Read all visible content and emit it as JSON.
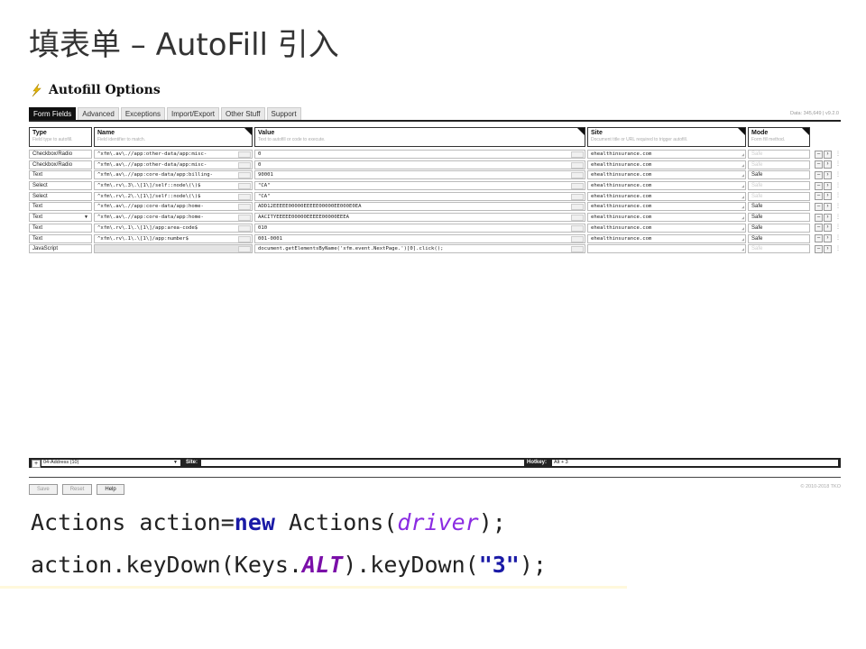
{
  "slide": {
    "title": "填表单 – AutoFill 引入"
  },
  "app": {
    "title": "Autofill Options"
  },
  "tabs": [
    {
      "label": "Form Fields",
      "active": true
    },
    {
      "label": "Advanced"
    },
    {
      "label": "Exceptions"
    },
    {
      "label": "Import/Export"
    },
    {
      "label": "Other Stuff"
    },
    {
      "label": "Support"
    }
  ],
  "data_version": "Data: 345,649  |  v9.2.0",
  "columns": {
    "type": {
      "title": "Type",
      "hint": "Field type to autofill."
    },
    "name": {
      "title": "Name",
      "hint": "Field identifier to match."
    },
    "value": {
      "title": "Value",
      "hint": "Text to autofill or code to execute."
    },
    "site": {
      "title": "Site",
      "hint": "Document title or URL required to trigger autofill."
    },
    "mode": {
      "title": "Mode",
      "hint": "Form fill method."
    }
  },
  "rows": [
    {
      "type": "Checkbox/Radio",
      "name": "^xfm\\.av\\.//app:other-data/app:misc-",
      "value": "0",
      "site": "ehealthinsurance.com",
      "mode": "Safe",
      "mode_dim": true
    },
    {
      "type": "Checkbox/Radio",
      "name": "^xfm\\.av\\.//app:other-data/app:misc-",
      "value": "0",
      "site": "ehealthinsurance.com",
      "mode": "Safe",
      "mode_dim": true
    },
    {
      "type": "Text",
      "name": "^xfm\\.av\\.//app:core-data/app:billing-",
      "value": "90001",
      "site": "ehealthinsurance.com",
      "mode": "Safe",
      "mode_dim": false
    },
    {
      "type": "Select",
      "name": "^xfm\\.rv\\.3\\.\\[1\\]/self::node\\(\\)$",
      "value": "\"CA\"",
      "site": "ehealthinsurance.com",
      "mode": "Safe",
      "mode_dim": true
    },
    {
      "type": "Select",
      "name": "^xfm\\.rv\\.2\\.\\[1\\]/self::node\\(\\)$",
      "value": "\"CA\"",
      "site": "ehealthinsurance.com",
      "mode": "Safe",
      "mode_dim": true
    },
    {
      "type": "Text",
      "name": "^xfm\\.av\\.//app:core-data/app:home-",
      "value": "ADD12EEEEE00000EEEEE00000EE000E0EA",
      "site": "ehealthinsurance.com",
      "mode": "Safe",
      "mode_dim": false
    },
    {
      "type": "Text",
      "name": "^xfm\\.av\\.//app:core-data/app:home-",
      "value": "AACITYEEEEE00000EEEEE00000EEEA",
      "site": "ehealthinsurance.com",
      "mode": "Safe",
      "mode_dim": false,
      "select": true
    },
    {
      "type": "Text",
      "name": "^xfm\\.rv\\.1\\.\\[1\\]/app:area-code$",
      "value": "010",
      "site": "ehealthinsurance.com",
      "mode": "Safe",
      "mode_dim": false
    },
    {
      "type": "Text",
      "name": "^xfm\\.rv\\.1\\.\\[1\\]/app:number$",
      "value": "001-0001",
      "site": "ehealthinsurance.com",
      "mode": "Safe",
      "mode_dim": false
    },
    {
      "type": "JavaScript",
      "name": "",
      "value": "document.getElementsByName('xfm.event.NextPage.')[0].click();",
      "site": "",
      "mode": "Safe",
      "mode_dim": true,
      "name_gray": true
    }
  ],
  "bottom": {
    "add": "+",
    "profile": "04-Address (10)",
    "site_label": "Site:",
    "site_value": "",
    "hotkey_label": "Hotkey:",
    "hotkey_value": "Alt + 3"
  },
  "actions": {
    "save": "Save",
    "reset": "Reset",
    "help": "Help"
  },
  "copyright": "© 2010-2018 TKO",
  "code": {
    "line1": {
      "a": "Actions action=",
      "kw": "new",
      "b": " Actions(",
      "var": "driver",
      "c": ");"
    },
    "line2": {
      "a": "action.keyDown(Keys.",
      "const": "ALT",
      "b": ").keyDown(",
      "str": "\"3\"",
      "c": ");"
    }
  }
}
